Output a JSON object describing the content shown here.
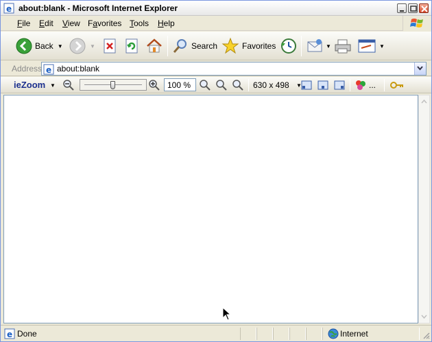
{
  "window": {
    "title": "about:blank - Microsoft Internet Explorer"
  },
  "menu": {
    "items": [
      "File",
      "Edit",
      "View",
      "Favorites",
      "Tools",
      "Help"
    ],
    "accelerators": [
      "F",
      "E",
      "V",
      "a",
      "T",
      "H"
    ]
  },
  "toolbar": {
    "back_label": "Back",
    "search_label": "Search",
    "favorites_label": "Favorites"
  },
  "address": {
    "label": "Address",
    "url": "about:blank"
  },
  "zoombar": {
    "brand": "ieZoom",
    "zoom_percent": "100 %",
    "window_size": "630 x 498",
    "more_label": "...",
    "slider_level": 0.5
  },
  "status": {
    "text": "Done",
    "zone": "Internet"
  },
  "colors": {
    "chrome": "#ece9d8",
    "brand": "#1b2f8e",
    "address_border": "#7f9db9"
  }
}
